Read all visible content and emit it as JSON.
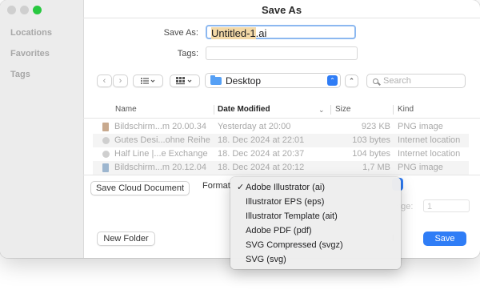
{
  "window": {
    "title": "Save As",
    "sidebar": {
      "sections": [
        "Locations",
        "Favorites",
        "Tags"
      ]
    }
  },
  "form": {
    "save_as_label": "Save As:",
    "filename_base": "Untitled-1",
    "filename_ext": ".ai",
    "tags_label": "Tags:"
  },
  "toolbar": {
    "location": "Desktop",
    "search_placeholder": "Search"
  },
  "table": {
    "columns": [
      "Name",
      "Date Modified",
      "Size",
      "Kind"
    ],
    "rows": [
      {
        "name": "Bildschirm...m 20.00.34",
        "date": "Yesterday at 20:00",
        "size": "923 KB",
        "kind": "PNG image",
        "icon": "png-file-icon"
      },
      {
        "name": "Gutes Desi...ohne Reihe",
        "date": "18. Dec 2024 at 22:01",
        "size": "103 bytes",
        "kind": "Internet location",
        "icon": "internet-location-icon"
      },
      {
        "name": "Half Line |...e Exchange",
        "date": "18. Dec 2024 at 20:37",
        "size": "104 bytes",
        "kind": "Internet location",
        "icon": "internet-location-icon"
      },
      {
        "name": "Bildschirm...m 20.12.04",
        "date": "18. Dec 2024 at 20:12",
        "size": "1,7 MB",
        "kind": "PNG image",
        "icon": "png-file-icon"
      }
    ]
  },
  "bottom": {
    "save_cloud_label": "Save Cloud Document",
    "format_label": "Format",
    "range_label": "nge:",
    "range_value": "1",
    "new_folder_label": "New Folder",
    "cancel_partial": "l",
    "save_label": "Save"
  },
  "format_menu": {
    "selected_mark": "✓",
    "items": [
      "Adobe Illustrator (ai)",
      "Illustrator EPS (eps)",
      "Illustrator Template (ait)",
      "Adobe PDF (pdf)",
      "SVG Compressed (svgz)",
      "SVG (svg)"
    ]
  },
  "colors": {
    "accent": "#2f7df6",
    "selection_highlight": "#f3d9a7",
    "window_max": "#28c840"
  }
}
